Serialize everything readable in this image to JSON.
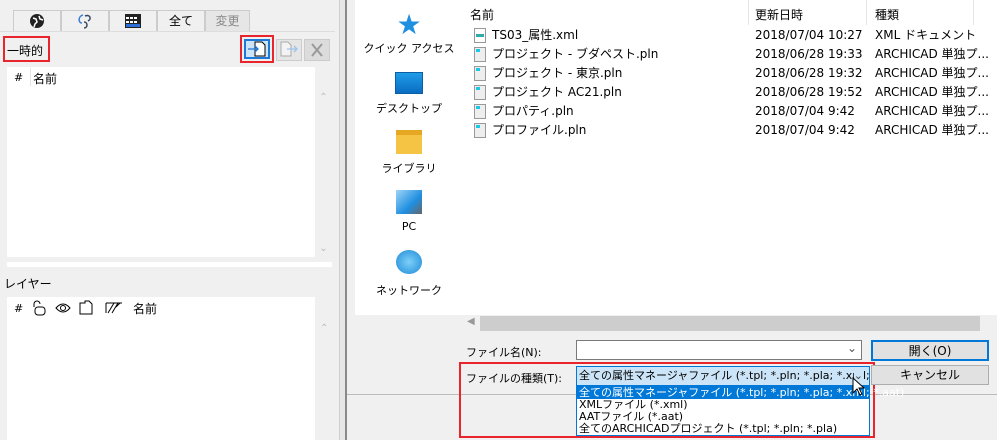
{
  "left_panel": {
    "tabs": [
      {
        "icon": "globe-icon"
      },
      {
        "icon": "attributes-icon"
      },
      {
        "icon": "grid-icon"
      },
      {
        "label": "全て"
      },
      {
        "label": "変更"
      }
    ],
    "temp_section_title": "一時的",
    "temp_columns": [
      "#",
      "名前"
    ],
    "layer_section_title": "レイヤー",
    "layer_columns": [
      "#",
      "lock-icon",
      "eye-icon",
      "folder-icon",
      "hatch-icon",
      "名前"
    ]
  },
  "dialog": {
    "nav": [
      {
        "label": "クイック アクセス",
        "icon": "star-icon"
      },
      {
        "label": "デスクトップ",
        "icon": "desktop-icon"
      },
      {
        "label": "ライブラリ",
        "icon": "library-icon"
      },
      {
        "label": "PC",
        "icon": "pc-icon"
      },
      {
        "label": "ネットワーク",
        "icon": "network-icon"
      }
    ],
    "columns": [
      "名前",
      "更新日時",
      "種類"
    ],
    "files": [
      {
        "name": "TS03_属性.xml",
        "date": "2018/07/04 10:27",
        "type": "XML ドキュメント"
      },
      {
        "name": "プロジェクト - ブダペスト.pln",
        "date": "2018/06/28 19:33",
        "type": "ARCHICAD 単独プ..."
      },
      {
        "name": "プロジェクト - 東京.pln",
        "date": "2018/06/28 19:32",
        "type": "ARCHICAD 単独プ..."
      },
      {
        "name": "プロジェクト AC21.pln",
        "date": "2018/06/28 19:52",
        "type": "ARCHICAD 単独プ..."
      },
      {
        "name": "プロパティ.pln",
        "date": "2018/07/04 9:42",
        "type": "ARCHICAD 単独プ..."
      },
      {
        "name": "プロファイル.pln",
        "date": "2018/07/04 9:42",
        "type": "ARCHICAD 単独プ..."
      }
    ],
    "filename_label": "ファイル名(N):",
    "filename_value": "",
    "filetype_label": "ファイルの種類(T):",
    "filetype_selected": "全ての属性マネージャファイル (*.tpl; *.pln; *.pla; *.xml; *",
    "filetype_options": [
      "全ての属性マネージャファイル (*.tpl; *.pln; *.pla; *.xml; *.aat)",
      "XMLファイル (*.xml)",
      "AATファイル (*.aat)",
      "全てのARCHICADプロジェクト (*.tpl; *.pln; *.pla)"
    ],
    "open_label": "開く(O)",
    "cancel_label": "キャンセル"
  }
}
